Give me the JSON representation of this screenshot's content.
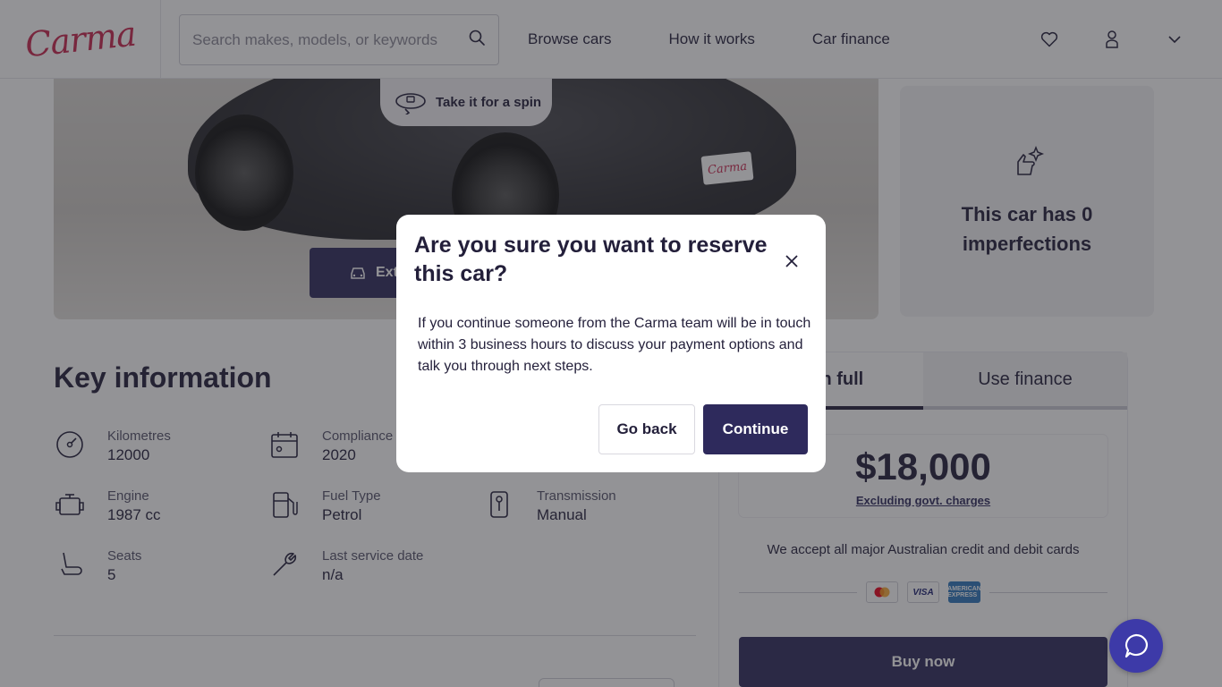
{
  "header": {
    "logo": "Carma",
    "search_placeholder": "Search makes, models, or keywords",
    "nav": [
      "Browse cars",
      "How it works",
      "Car finance"
    ]
  },
  "hero": {
    "spin_label": "Take it for a spin",
    "exterior_button": "Exte",
    "plate_text": "Carma"
  },
  "imperfections": {
    "text": "This car has 0 imperfections"
  },
  "key_info": {
    "title": "Key information",
    "specs": [
      {
        "label": "Kilometres",
        "value": "12000",
        "icon": "speedometer-icon"
      },
      {
        "label": "Compliance",
        "value": "2020",
        "icon": "calendar-icon"
      },
      {
        "label": "Engine",
        "value": "1987 cc",
        "icon": "engine-icon"
      },
      {
        "label": "Fuel Type",
        "value": "Petrol",
        "icon": "fuel-pump-icon"
      },
      {
        "label": "Transmission",
        "value": "Manual",
        "icon": "gear-shift-icon"
      },
      {
        "label": "Seats",
        "value": "5",
        "icon": "seat-icon"
      },
      {
        "label": "Last service date",
        "value": "n/a",
        "icon": "wrench-icon"
      }
    ]
  },
  "price_card": {
    "tab_full": "Pay in full",
    "tab_finance": "Use finance",
    "price": "$18,000",
    "excluding": "Excluding govt. charges",
    "accept_text": "We accept all major Australian credit and debit cards",
    "cards": [
      "mastercard",
      "VISA",
      "AMERICAN EXPRESS"
    ],
    "buy_label": "Buy now"
  },
  "modal": {
    "title": "Are you sure you want to reserve this car?",
    "body": "If you continue someone from the Carma team will be in touch within 3 business hours to discuss your payment options and talk you through next steps.",
    "go_back": "Go back",
    "continue": "Continue"
  },
  "colors": {
    "brand": "#c9264e",
    "primary": "#2e2a5c",
    "text": "#231f3a",
    "chat": "#3d3aa8"
  }
}
